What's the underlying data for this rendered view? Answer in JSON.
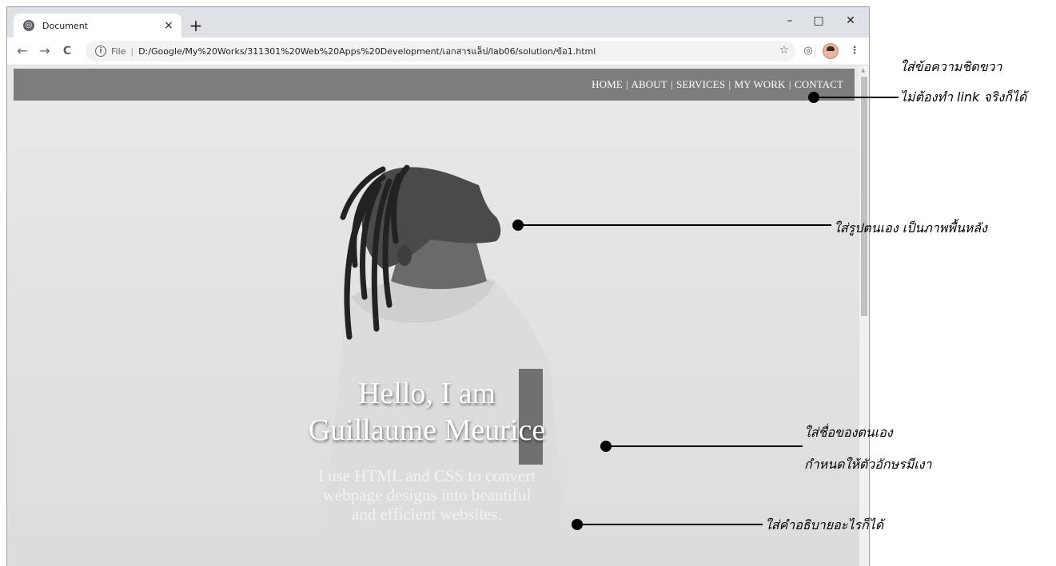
{
  "browser": {
    "tab_title": "Document",
    "tab_close": "×",
    "new_tab": "+",
    "window_controls": {
      "minimize": "–",
      "maximize": "□",
      "close": "✕"
    },
    "nav": {
      "back": "←",
      "forward": "→",
      "reload": "C"
    },
    "omnibox": {
      "scheme": "File",
      "url": "D:/Google/My%20Works/311301%20Web%20Apps%20Development/เอกสารแล็ป/lab06/solution/ข้อ1.html"
    },
    "toolbar_icons": [
      "star-icon",
      "extension-icon",
      "avatar",
      "menu-icon"
    ]
  },
  "site": {
    "nav_items": [
      "HOME",
      "ABOUT",
      "SERVICES",
      "MY WORK",
      "CONTACT"
    ],
    "separator": "|",
    "hero": {
      "line1": "Hello, I am",
      "line2": "Guillaume Meurice",
      "description_lines": [
        "I use HTML and CSS to convert",
        "webpage designs into beautiful",
        "and efficient websites."
      ]
    }
  },
  "annotations": {
    "nav_note_line1": "ใส่ข้อความชิดขวา",
    "nav_note_line2": "ไม่ต้องทำ link จริงก็ได้",
    "photo_note": "ใส่รูปตนเอง เป็นภาพพื้นหลัง",
    "name_note_line1": "ใส่ชื่อของตนเอง",
    "name_note_line2": "กำหนดให้ตัวอักษรมีเงา",
    "desc_note": "ใส่คำอธิบายอะไรก็ได้"
  },
  "colors": {
    "nav_bar": "#7d7d7d",
    "page_bg": "#e2e2e2",
    "hero_text": "#ffffff"
  }
}
